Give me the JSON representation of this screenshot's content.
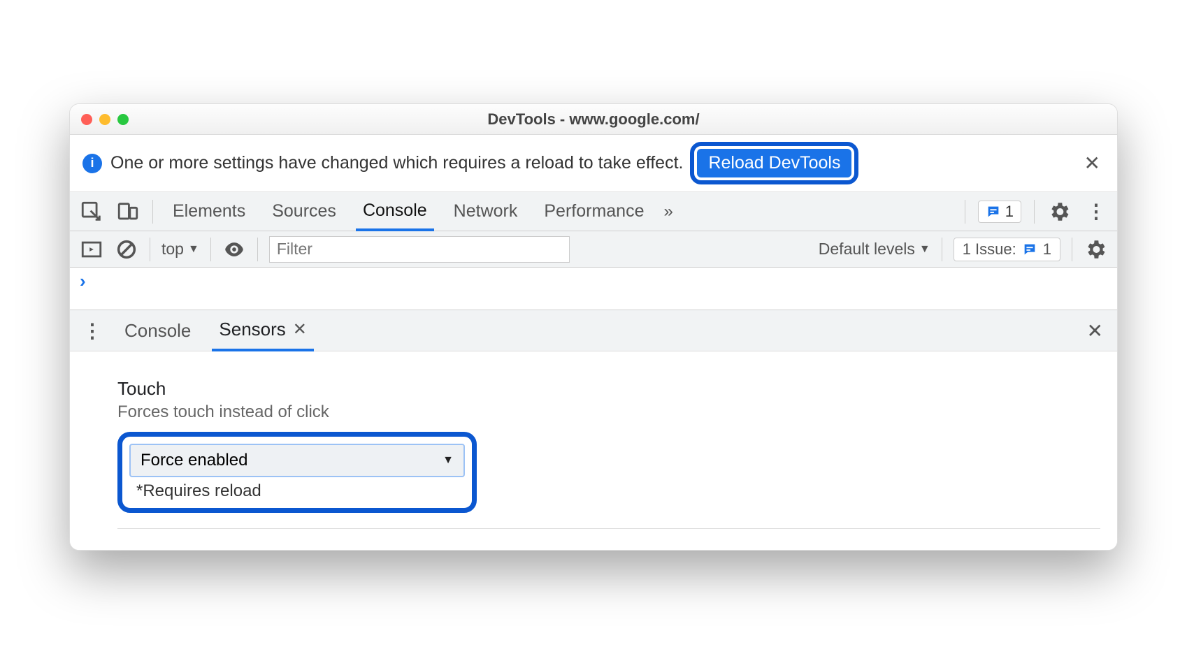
{
  "title": "DevTools - www.google.com/",
  "infobar": {
    "message": "One or more settings have changed which requires a reload to take effect.",
    "button": "Reload DevTools"
  },
  "tabs": {
    "items": [
      "Elements",
      "Sources",
      "Console",
      "Network",
      "Performance"
    ],
    "active": "Console",
    "badge_count": "1"
  },
  "consolebar": {
    "context": "top",
    "filter_placeholder": "Filter",
    "levels": "Default levels",
    "issues_label": "1 Issue:",
    "issues_count": "1"
  },
  "drawer": {
    "tabs": [
      "Console",
      "Sensors"
    ],
    "active": "Sensors"
  },
  "sensors": {
    "label": "Touch",
    "sublabel": "Forces touch instead of click",
    "select_value": "Force enabled",
    "note": "*Requires reload"
  }
}
